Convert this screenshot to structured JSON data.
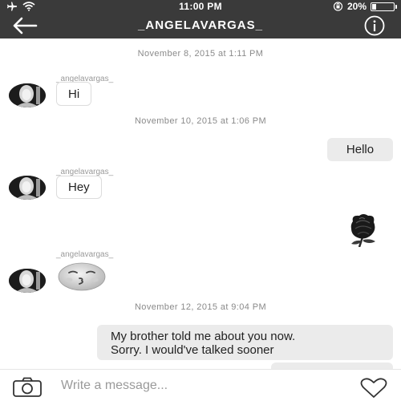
{
  "status_bar": {
    "time": "11:00 PM",
    "battery_percent": "20%",
    "battery_level": 0.2
  },
  "header": {
    "title": "_ANGELAVARGAS_",
    "back_icon": "arrow-left-icon",
    "info_icon": "info-icon"
  },
  "thread": {
    "timestamps": [
      "November 8, 2015 at 1:11 PM",
      "November 10, 2015 at 1:06 PM",
      "November 12, 2015 at 9:04 PM"
    ],
    "sender_name": "_angelavargas_",
    "messages": [
      {
        "from": "them",
        "text": "Hi"
      },
      {
        "from": "me",
        "text": "Hello"
      },
      {
        "from": "them",
        "text": "Hey"
      },
      {
        "from": "me",
        "sticker": "black-rose"
      },
      {
        "from": "them",
        "sticker": "kissing-face-emoji"
      },
      {
        "from": "me",
        "lines": [
          "My brother told me about you now.",
          "Sorry. I would've talked sooner"
        ]
      }
    ]
  },
  "composer": {
    "placeholder": "Write a message...",
    "camera_icon": "camera-icon",
    "heart_icon": "heart-icon"
  },
  "colors": {
    "header_bg": "#3a3a3a",
    "outgoing_bubble": "#ebebeb",
    "timestamp_text": "#8a8a8a"
  }
}
